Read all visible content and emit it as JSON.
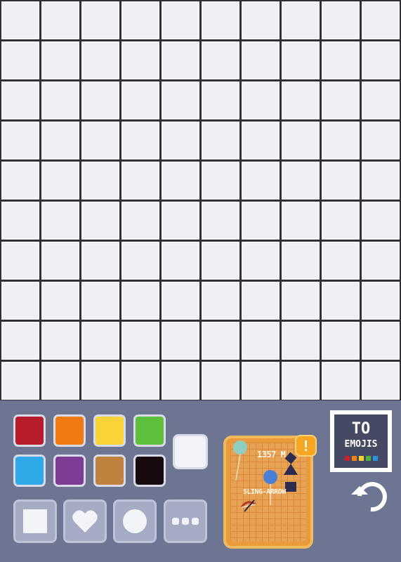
{
  "grid": {
    "rows": 10,
    "cols": 10
  },
  "palette": {
    "colors": [
      "#b71c2a",
      "#f27a12",
      "#fad339",
      "#5cc03c",
      "#2ea8e6",
      "#7e3c94",
      "#c0803e",
      "#170b10"
    ],
    "selected": "#f2f3f7"
  },
  "tools": [
    "square-shape",
    "heart-shape",
    "circle-shape",
    "more-options"
  ],
  "card": {
    "distance": "1357 M",
    "name": "SLING-ARROW",
    "alert": "!"
  },
  "to_emojis": {
    "line1": "TO",
    "line2": "EMOJIS",
    "dot_colors": [
      "#c82030",
      "#f0801a",
      "#f8d030",
      "#50b040",
      "#2890e0"
    ]
  },
  "icons": {
    "undo": "undo-icon"
  }
}
